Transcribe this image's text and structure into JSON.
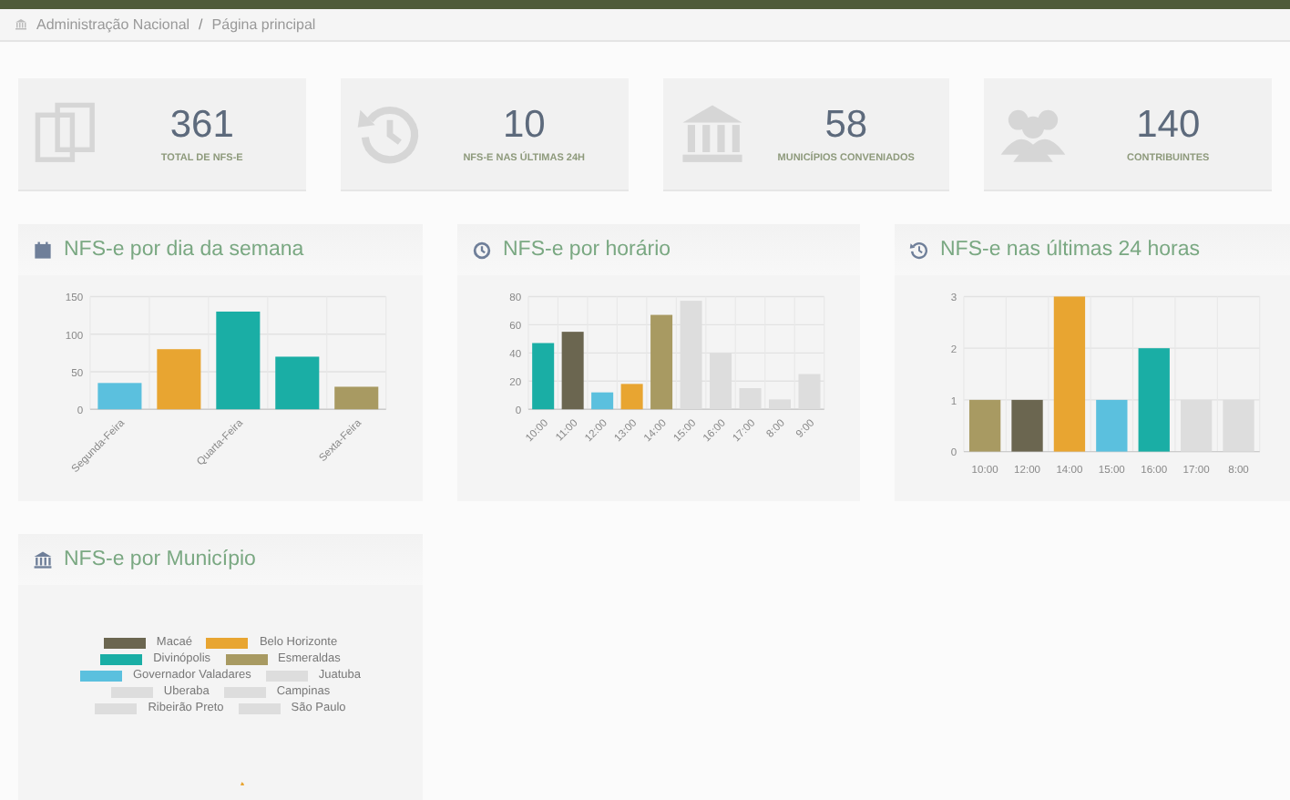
{
  "breadcrumb": {
    "items": [
      "Administração Nacional",
      "Página principal"
    ],
    "separator": "/"
  },
  "stats": [
    {
      "value": "361",
      "label": "TOTAL DE NFS-E",
      "kind": "documents"
    },
    {
      "value": "10",
      "label": "NFS-E NAS ÚLTIMAS 24H",
      "kind": "history"
    },
    {
      "value": "58",
      "label": "MUNICÍPIOS CONVENIADOS",
      "kind": "bank"
    },
    {
      "value": "140",
      "label": "CONTRIBUINTES",
      "kind": "users"
    }
  ],
  "panels": [
    {
      "title": "NFS-e por dia da semana",
      "chart_data": {
        "type": "bar",
        "categories": [
          "Segunda-Feira",
          null,
          "Quarta-Feira",
          null,
          "Sexta-Feira"
        ],
        "yticks": [
          0,
          50,
          100,
          150
        ],
        "ylim": [
          0,
          150
        ],
        "grid": true,
        "series": [
          {
            "values": [
              35,
              80,
              130,
              70,
              30
            ],
            "colors": [
              "#5bc0de",
              "#e8a531",
              "#1aaea5",
              "#1aaea5",
              "#a89a62"
            ]
          }
        ]
      }
    },
    {
      "title": "NFS-e por horário",
      "chart_data": {
        "type": "bar",
        "categories": [
          "10:00",
          "11:00",
          "12:00",
          "13:00",
          "14:00",
          "15:00",
          "16:00",
          "17:00",
          "8:00",
          "9:00"
        ],
        "yticks": [
          0,
          20,
          40,
          60,
          80
        ],
        "ylim": [
          0,
          80
        ],
        "grid": true,
        "series": [
          {
            "values": [
              47,
              55,
              12,
              18,
              67,
              77,
              40,
              15,
              7,
              25
            ],
            "colors": [
              "#1aaea5",
              "#6b6650",
              "#5bc0de",
              "#e8a531",
              "#a89a62",
              "#dddddd",
              "#dddddd",
              "#dddddd",
              "#dddddd",
              "#dddddd"
            ]
          }
        ]
      }
    },
    {
      "title": "NFS-e nas últimas 24 horas",
      "chart_data": {
        "type": "bar",
        "categories": [
          "10:00",
          "12:00",
          "14:00",
          "15:00",
          "16:00",
          "17:00",
          "8:00"
        ],
        "yticks": [
          0,
          1,
          2,
          3
        ],
        "ylim": [
          0,
          3
        ],
        "grid": true,
        "series": [
          {
            "values": [
              1,
              1,
              3,
              1,
              2,
              1,
              1
            ],
            "colors": [
              "#a89a62",
              "#6b6650",
              "#e8a531",
              "#5bc0de",
              "#1aaea5",
              "#dddddd",
              "#dddddd"
            ]
          }
        ]
      }
    },
    {
      "title": "NFS-e por Município",
      "legend": [
        {
          "name": "Macaé",
          "color": "#6b6650"
        },
        {
          "name": "Belo Horizonte",
          "color": "#e8a531"
        },
        {
          "name": "Divinópolis",
          "color": "#1aaea5"
        },
        {
          "name": "Esmeraldas",
          "color": "#a89a62"
        },
        {
          "name": "Governador Valadares",
          "color": "#5bc0de"
        },
        {
          "name": "Juatuba",
          "color": "#dddddd"
        },
        {
          "name": "Uberaba",
          "color": "#dddddd"
        },
        {
          "name": "Campinas",
          "color": "#dddddd"
        },
        {
          "name": "Ribeirão Preto",
          "color": "#dddddd"
        },
        {
          "name": "São Paulo",
          "color": "#dddddd"
        }
      ]
    }
  ]
}
